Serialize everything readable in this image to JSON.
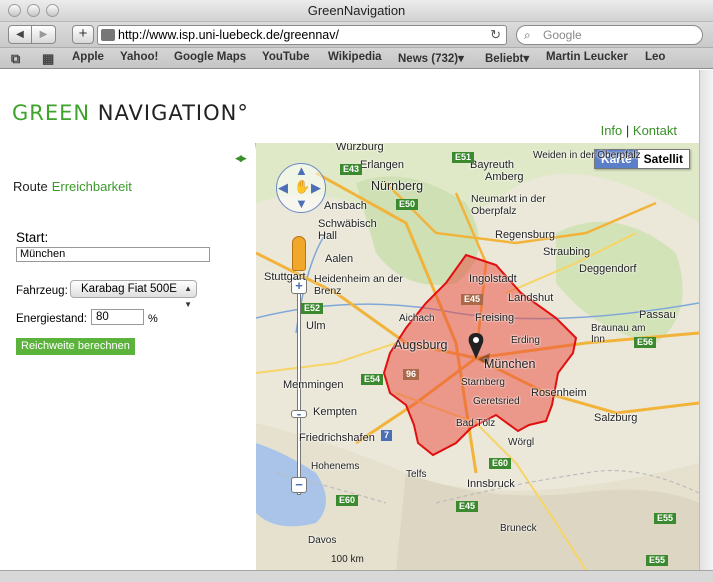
{
  "browser": {
    "window_title": "GreenNavigation",
    "url": "http://www.isp.uni-luebeck.de/greennav/",
    "search_placeholder": "Google",
    "bookmarks": [
      "Apple",
      "Yahoo!",
      "Google Maps",
      "YouTube",
      "Wikipedia",
      "News (732)▾",
      "Beliebt▾",
      "Martin Leucker",
      "Leo"
    ]
  },
  "header": {
    "logo_green": "GREEN",
    "logo_dark": " NAVIGATION°",
    "link_info": "Info",
    "separator": "|",
    "link_kontakt": "Kontakt"
  },
  "sidebar": {
    "collapse_icon": "◀▶",
    "tab_route": "Route",
    "tab_reach": "Erreichbarkeit",
    "start_label": "Start:",
    "start_value": "München",
    "vehicle_label": "Fahrzeug:",
    "vehicle_value": "Karabag Fiat 500E",
    "energy_label": "Energiestand:",
    "energy_value": "80",
    "energy_unit": "%",
    "submit_label": "Reichweite berechnen"
  },
  "map": {
    "type_map": "Karte",
    "type_satellite": "Satellit",
    "scale_label": "100 km",
    "cities": [
      "Würzburg",
      "Erlangen",
      "Bayreuth",
      "Weiden in der Oberpfalz",
      "Nürnberg",
      "Amberg",
      "Ansbach",
      "Neumarkt in der Oberpfalz",
      "Schwäbisch Hall",
      "Regensburg",
      "Straubing",
      "Aalen",
      "Deggendorf",
      "Heidenheim an der Brenz",
      "Ingolstadt",
      "Landshut",
      "Stuttgart",
      "Ulm",
      "Freising",
      "Passau",
      "Aichach",
      "Augsburg",
      "Erding",
      "München",
      "Braunau am Inn",
      "Memmingen",
      "Starnberg",
      "Rosenheim",
      "Kempten",
      "Geretsried",
      "Salzburg",
      "Friedrichshafen",
      "Bad Tölz",
      "Wörgl",
      "Innsbruck",
      "Hohenems",
      "Telfs",
      "Davos",
      "Bruneck"
    ],
    "roads": [
      "E43",
      "E51",
      "E50",
      "E45",
      "E52",
      "E54",
      "96",
      "7",
      "E60",
      "E56",
      "E55",
      "E45",
      "E60",
      "E55"
    ]
  }
}
